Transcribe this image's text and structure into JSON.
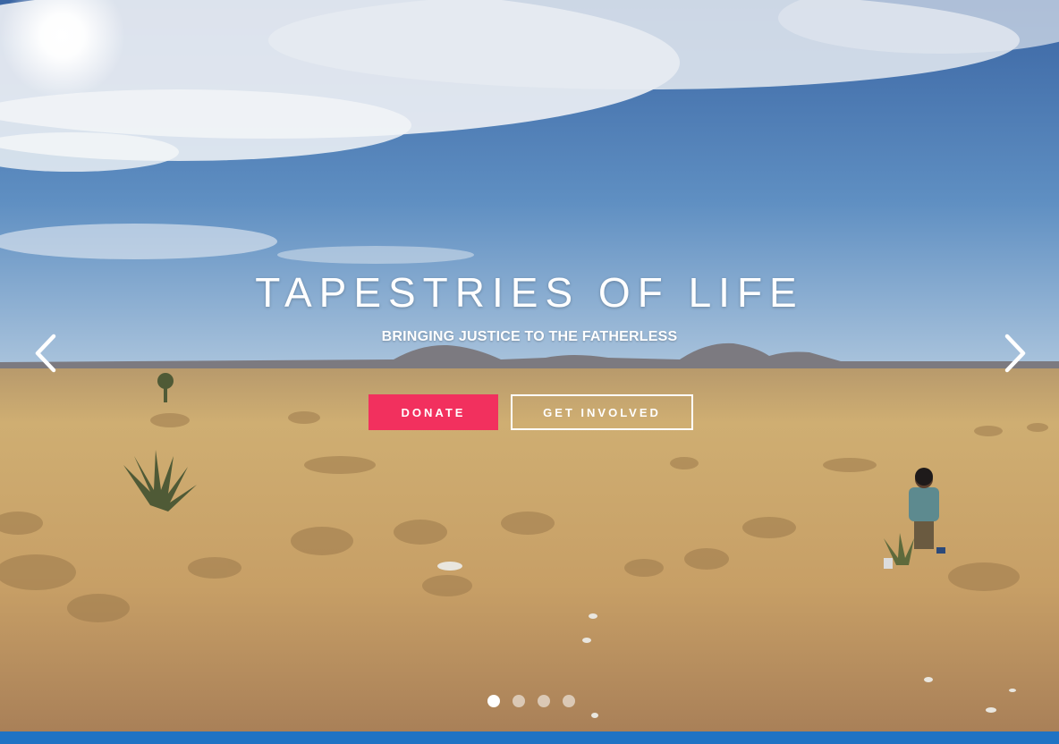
{
  "hero": {
    "title": "TAPESTRIES OF LIFE",
    "subtitle": "BRINGING JUSTICE TO THE FATHERLESS",
    "donate_label": "DONATE",
    "involved_label": "GET INVOLVED",
    "prev_icon": "chevron-left-icon",
    "next_icon": "chevron-right-icon",
    "slide_count": 4,
    "active_slide": 1
  },
  "colors": {
    "donate": "#f2305e",
    "bottom_bar": "#1f73c4",
    "sky_top": "#3d6aa8",
    "grass": "#c9a66b"
  }
}
